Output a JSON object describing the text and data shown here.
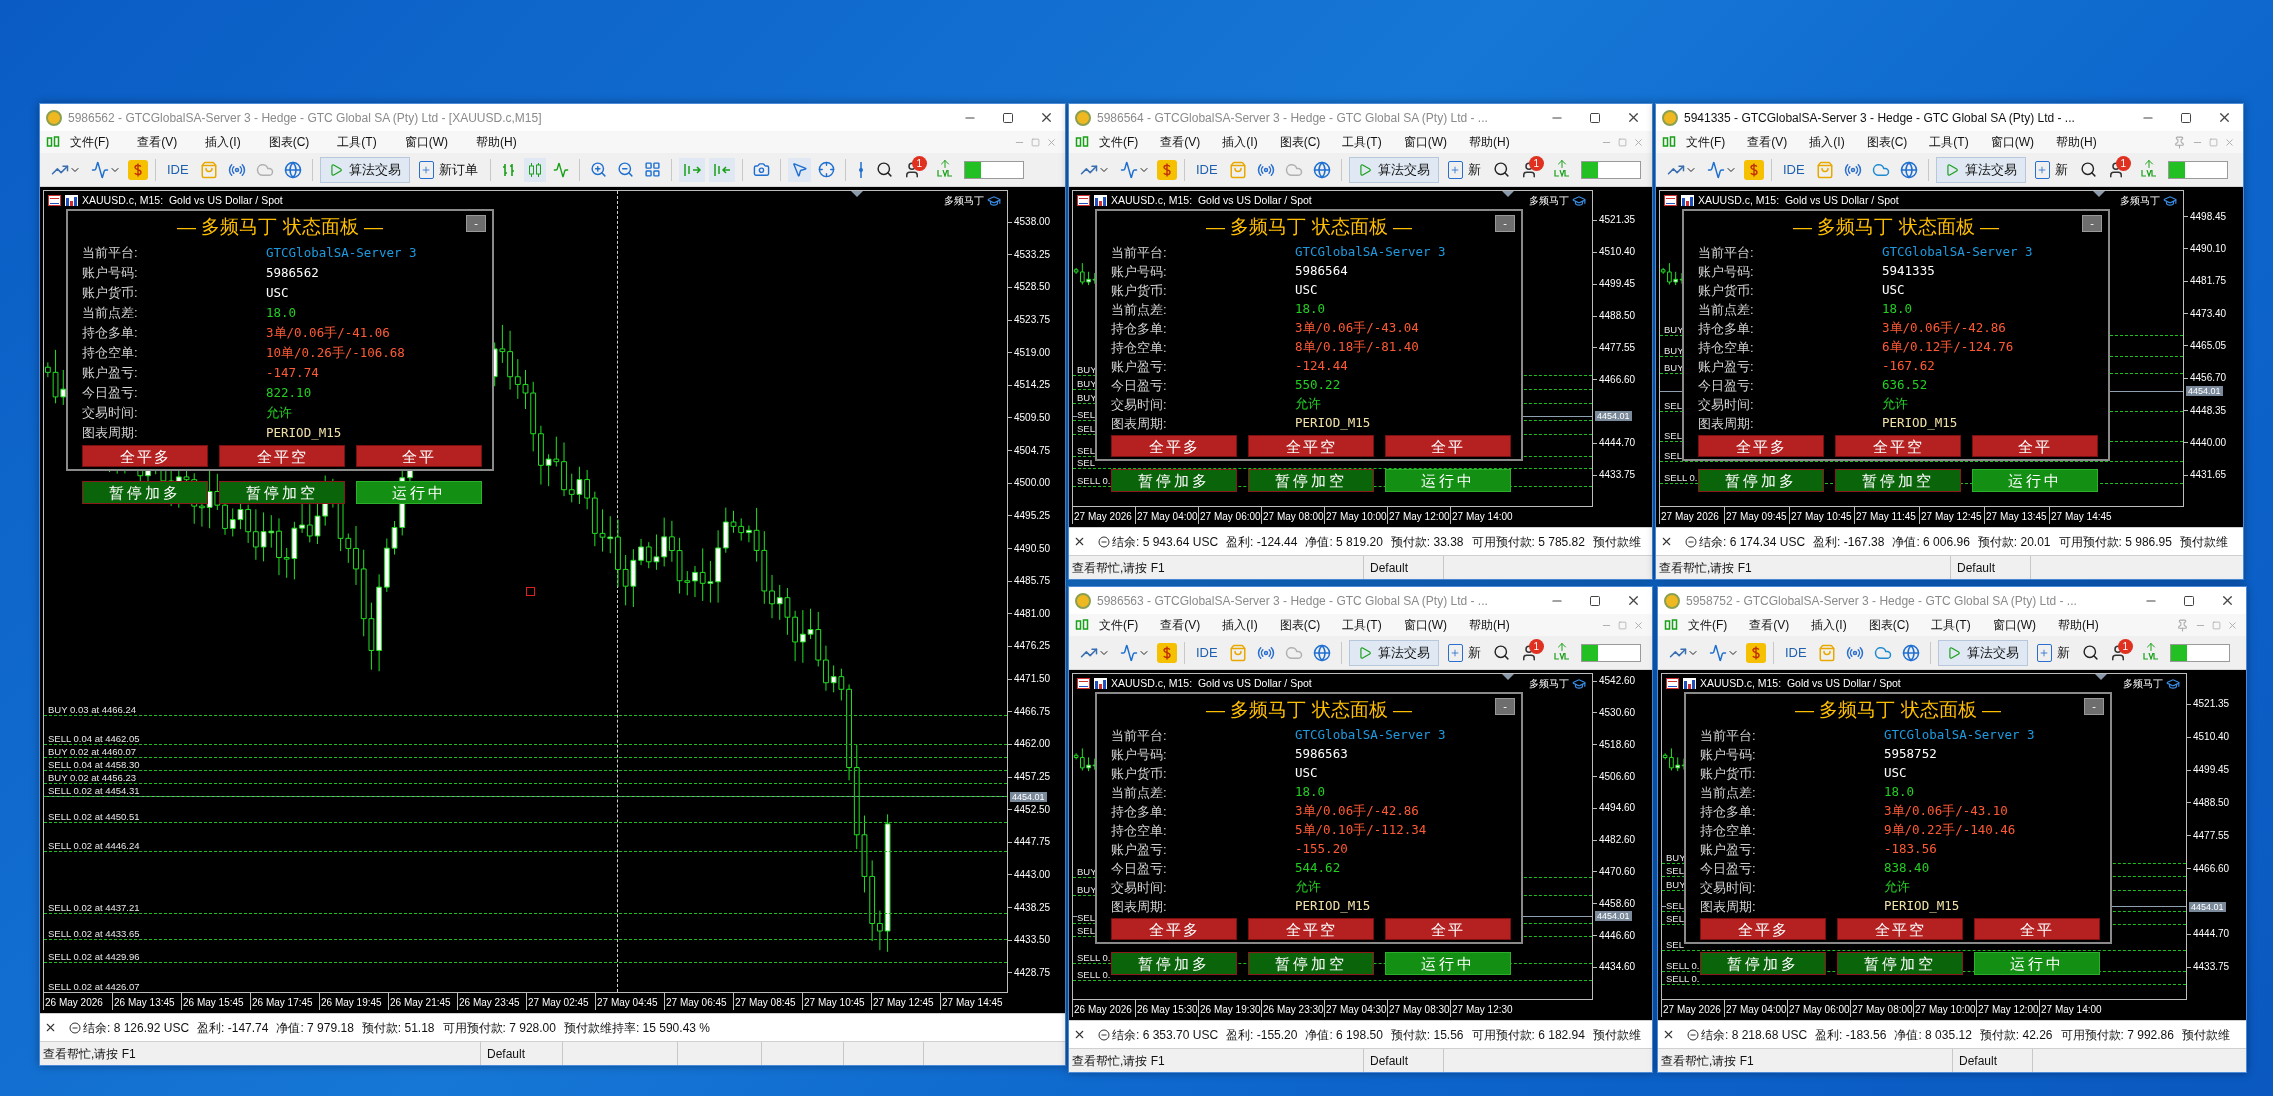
{
  "windows": [
    {
      "title": "5986562 - GTCGlobalSA-Server 3 - Hedge - GTC Global SA (Pty) Ltd - [XAUUSD.c,M15]",
      "active": false,
      "menu": [
        "文件(F)",
        "查看(V)",
        "插入(I)",
        "图表(C)",
        "工具(T)",
        "窗口(W)",
        "帮助(H)"
      ],
      "toolbar": {
        "kind": "full",
        "ide": "IDE",
        "algo": "算法交易",
        "new_order": "新订单",
        "badge": "1"
      },
      "chart": {
        "symbol": "XAUUSD.c, M15:  Gold vs US Dollar / Spot",
        "ea": "多频马丁",
        "price_ticks": [
          "4538.00",
          "4533.25",
          "4528.50",
          "4523.75",
          "4519.00",
          "4514.25",
          "4509.50",
          "4504.75",
          "4500.00",
          "4495.25",
          "4490.50",
          "4485.75",
          "4481.00",
          "4476.25",
          "4471.50",
          "4466.75",
          "4462.00",
          "4457.25",
          "4452.50",
          "4447.75",
          "4443.00",
          "4438.25",
          "4433.50",
          "4428.75"
        ],
        "current_price": "4454.01",
        "time_ticks": [
          "26 May 2026",
          "26 May 13:45",
          "26 May 15:45",
          "26 May 17:45",
          "26 May 19:45",
          "26 May 21:45",
          "26 May 23:45",
          "27 May 02:45",
          "27 May 04:45",
          "27 May 06:45",
          "27 May 08:45",
          "27 May 10:45",
          "27 May 12:45",
          "27 May 14:45"
        ],
        "order_labels": [
          "BUY 0.03 at 4466.24",
          "SELL 0.04 at 4462.05",
          "BUY 0.02 at 4460.07",
          "SELL 0.04 at 4458.30",
          "BUY 0.02 at 4456.23",
          "SELL 0.02 at 4454.31",
          "SELL 0.02 at 4450.51",
          "SELL 0.02 at 4446.24",
          "SELL 0.02 at 4437.21",
          "SELL 0.02 at 4433.65",
          "SELL 0.02 at 4429.96",
          "SELL 0.02 at 4426.07"
        ]
      },
      "panel": {
        "title": "— 多频马丁 状态面板 —",
        "collapse": "-",
        "rows": [
          {
            "label": "当前平台:",
            "value": "GTCGlobalSA-Server 3",
            "kind": "server"
          },
          {
            "label": "账户号码:",
            "value": "5986562",
            "kind": "plain"
          },
          {
            "label": "账户货币:",
            "value": "USC",
            "kind": "plain"
          },
          {
            "label": "当前点差:",
            "value": "18.0",
            "kind": "good"
          },
          {
            "label": "持仓多单:",
            "value": "3单/0.06手/-41.06",
            "kind": "bad"
          },
          {
            "label": "持仓空单:",
            "value": "10单/0.26手/-106.68",
            "kind": "bad"
          },
          {
            "label": "账户盈亏:",
            "value": "-147.74",
            "kind": "bad"
          },
          {
            "label": "今日盈亏:",
            "value": "822.10",
            "kind": "good"
          },
          {
            "label": "交易时间:",
            "value": "允许",
            "kind": "good"
          },
          {
            "label": "图表周期:",
            "value": "PERIOD_M15",
            "kind": "period"
          }
        ],
        "close_buttons": [
          "全平多",
          "全平空",
          "全平"
        ],
        "mode_buttons": [
          {
            "label": "暂停加多",
            "on": false
          },
          {
            "label": "暂停加空",
            "on": false
          },
          {
            "label": "运行中",
            "on": true
          }
        ]
      },
      "account": [
        "结余: 8 126.92 USC",
        "盈利: -147.74",
        "净值: 7 979.18",
        "预付款: 51.18",
        "可用预付款: 7 928.00",
        "预付款维持率: 15 590.43 %"
      ],
      "status_bar": {
        "help": "查看帮忙,请按 F1",
        "profile": "Default"
      }
    },
    {
      "title": "5986564 - GTCGlobalSA-Server 3 - Hedge - GTC Global SA (Pty) Ltd - ...",
      "active": false,
      "menu": [
        "文件(F)",
        "查看(V)",
        "插入(I)",
        "图表(C)",
        "工具(T)",
        "窗口(W)",
        "帮助(H)"
      ],
      "toolbar": {
        "kind": "compact",
        "ide": "IDE",
        "algo": "算法交易",
        "new_order": "新",
        "badge": "1"
      },
      "chart": {
        "symbol": "XAUUSD.c, M15:  Gold vs US Dollar / Spot",
        "ea": "多频马丁",
        "price_ticks": [
          "4521.35",
          "4510.40",
          "4499.45",
          "4488.50",
          "4477.55",
          "4466.60",
          "4444.70",
          "4433.75"
        ],
        "current_price": "4454.01",
        "time_ticks": [
          "27 May 2026",
          "27 May 04:00",
          "27 May 06:00",
          "27 May 08:00",
          "27 May 10:00",
          "27 May 12:00",
          "27 May 14:00"
        ],
        "order_labels": [
          "BUY",
          "BUY",
          "BUY",
          "SEL",
          "SEL",
          "SEL",
          "SEL",
          "SELL 0."
        ]
      },
      "panel": {
        "title": "— 多频马丁 状态面板 —",
        "collapse": "-",
        "rows": [
          {
            "label": "当前平台:",
            "value": "GTCGlobalSA-Server 3",
            "kind": "server"
          },
          {
            "label": "账户号码:",
            "value": "5986564",
            "kind": "plain"
          },
          {
            "label": "账户货币:",
            "value": "USC",
            "kind": "plain"
          },
          {
            "label": "当前点差:",
            "value": "18.0",
            "kind": "good"
          },
          {
            "label": "持仓多单:",
            "value": "3单/0.06手/-43.04",
            "kind": "bad"
          },
          {
            "label": "持仓空单:",
            "value": "8单/0.18手/-81.40",
            "kind": "bad"
          },
          {
            "label": "账户盈亏:",
            "value": "-124.44",
            "kind": "bad"
          },
          {
            "label": "今日盈亏:",
            "value": "550.22",
            "kind": "good"
          },
          {
            "label": "交易时间:",
            "value": "允许",
            "kind": "good"
          },
          {
            "label": "图表周期:",
            "value": "PERIOD_M15",
            "kind": "period"
          }
        ],
        "close_buttons": [
          "全平多",
          "全平空",
          "全平"
        ],
        "mode_buttons": [
          {
            "label": "暂停加多",
            "on": false
          },
          {
            "label": "暂停加空",
            "on": false
          },
          {
            "label": "运行中",
            "on": true
          }
        ]
      },
      "account": [
        "结余: 5 943.64 USC",
        "盈利: -124.44",
        "净值: 5 819.20",
        "预付款: 33.38",
        "可用预付款: 5 785.82",
        "预付款维"
      ],
      "status_bar": {
        "help": "查看帮忙,请按 F1",
        "profile": "Default"
      }
    },
    {
      "title": "5941335 - GTCGlobalSA-Server 3 - Hedge - GTC Global SA (Pty) Ltd - ...",
      "active": true,
      "menu": [
        "文件(F)",
        "查看(V)",
        "插入(I)",
        "图表(C)",
        "工具(T)",
        "窗口(W)",
        "帮助(H)"
      ],
      "toolbar": {
        "kind": "compact",
        "ide": "IDE",
        "algo": "算法交易",
        "new_order": "新",
        "badge": "1"
      },
      "chart": {
        "symbol": "XAUUSD.c, M15:  Gold vs US Dollar / Spot",
        "ea": "多频马丁",
        "price_ticks": [
          "4498.45",
          "4490.10",
          "4481.75",
          "4473.40",
          "4465.05",
          "4456.70",
          "4448.35",
          "4440.00",
          "4431.65"
        ],
        "current_price": "4454.01",
        "time_ticks": [
          "27 May 2026",
          "27 May 09:45",
          "27 May 10:45",
          "27 May 11:45",
          "27 May 12:45",
          "27 May 13:45",
          "27 May 14:45"
        ],
        "order_labels": [
          "BUY",
          "BUY",
          "BUY",
          "SEL",
          "SEL",
          "SEL",
          "SELL 0."
        ]
      },
      "panel": {
        "title": "— 多频马丁 状态面板 —",
        "collapse": "-",
        "rows": [
          {
            "label": "当前平台:",
            "value": "GTCGlobalSA-Server 3",
            "kind": "server"
          },
          {
            "label": "账户号码:",
            "value": "5941335",
            "kind": "plain"
          },
          {
            "label": "账户货币:",
            "value": "USC",
            "kind": "plain"
          },
          {
            "label": "当前点差:",
            "value": "18.0",
            "kind": "good"
          },
          {
            "label": "持仓多单:",
            "value": "3单/0.06手/-42.86",
            "kind": "bad"
          },
          {
            "label": "持仓空单:",
            "value": "6单/0.12手/-124.76",
            "kind": "bad"
          },
          {
            "label": "账户盈亏:",
            "value": "-167.62",
            "kind": "bad"
          },
          {
            "label": "今日盈亏:",
            "value": "636.52",
            "kind": "good"
          },
          {
            "label": "交易时间:",
            "value": "允许",
            "kind": "good"
          },
          {
            "label": "图表周期:",
            "value": "PERIOD_M15",
            "kind": "period"
          }
        ],
        "close_buttons": [
          "全平多",
          "全平空",
          "全平"
        ],
        "mode_buttons": [
          {
            "label": "暂停加多",
            "on": false
          },
          {
            "label": "暂停加空",
            "on": false
          },
          {
            "label": "运行中",
            "on": true
          }
        ]
      },
      "account": [
        "结余: 6 174.34 USC",
        "盈利: -167.38",
        "净值: 6 006.96",
        "预付款: 20.01",
        "可用预付款: 5 986.95",
        "预付款维"
      ],
      "status_bar": {
        "help": "查看帮忙,请按 F1",
        "profile": "Default"
      }
    },
    {
      "title": "5986563 - GTCGlobalSA-Server 3 - Hedge - GTC Global SA (Pty) Ltd - ...",
      "active": false,
      "menu": [
        "文件(F)",
        "查看(V)",
        "插入(I)",
        "图表(C)",
        "工具(T)",
        "窗口(W)",
        "帮助(H)"
      ],
      "toolbar": {
        "kind": "compact",
        "ide": "IDE",
        "algo": "算法交易",
        "new_order": "新",
        "badge": "1"
      },
      "chart": {
        "symbol": "XAUUSD.c, M15:  Gold vs US Dollar / Spot",
        "ea": "多频马丁",
        "price_ticks": [
          "4542.60",
          "4530.60",
          "4518.60",
          "4506.60",
          "4494.60",
          "4482.60",
          "4470.60",
          "4458.60",
          "4446.60",
          "4434.60"
        ],
        "current_price": "4454.01",
        "time_ticks": [
          "26 May 2026",
          "26 May 15:30",
          "26 May 19:30",
          "26 May 23:30",
          "27 May 04:30",
          "27 May 08:30",
          "27 May 12:30"
        ],
        "order_labels": [
          "BUY",
          "BUY",
          "SEL",
          "SEL",
          "SELL 0.",
          "SELL 0."
        ]
      },
      "panel": {
        "title": "— 多频马丁 状态面板 —",
        "collapse": "-",
        "rows": [
          {
            "label": "当前平台:",
            "value": "GTCGlobalSA-Server 3",
            "kind": "server"
          },
          {
            "label": "账户号码:",
            "value": "5986563",
            "kind": "plain"
          },
          {
            "label": "账户货币:",
            "value": "USC",
            "kind": "plain"
          },
          {
            "label": "当前点差:",
            "value": "18.0",
            "kind": "good"
          },
          {
            "label": "持仓多单:",
            "value": "3单/0.06手/-42.86",
            "kind": "bad"
          },
          {
            "label": "持仓空单:",
            "value": "5单/0.10手/-112.34",
            "kind": "bad"
          },
          {
            "label": "账户盈亏:",
            "value": "-155.20",
            "kind": "bad"
          },
          {
            "label": "今日盈亏:",
            "value": "544.62",
            "kind": "good"
          },
          {
            "label": "交易时间:",
            "value": "允许",
            "kind": "good"
          },
          {
            "label": "图表周期:",
            "value": "PERIOD_M15",
            "kind": "period"
          }
        ],
        "close_buttons": [
          "全平多",
          "全平空",
          "全平"
        ],
        "mode_buttons": [
          {
            "label": "暂停加多",
            "on": false
          },
          {
            "label": "暂停加空",
            "on": false
          },
          {
            "label": "运行中",
            "on": true
          }
        ]
      },
      "account": [
        "结余: 6 353.70 USC",
        "盈利: -155.20",
        "净值: 6 198.50",
        "预付款: 15.56",
        "可用预付款: 6 182.94",
        "预付款维"
      ],
      "status_bar": {
        "help": "查看帮忙,请按 F1",
        "profile": "Default"
      }
    },
    {
      "title": "5958752 - GTCGlobalSA-Server 3 - Hedge - GTC Global SA (Pty) Ltd - ...",
      "active": false,
      "menu": [
        "文件(F)",
        "查看(V)",
        "插入(I)",
        "图表(C)",
        "工具(T)",
        "窗口(W)",
        "帮助(H)"
      ],
      "toolbar": {
        "kind": "compact",
        "ide": "IDE",
        "algo": "算法交易",
        "new_order": "新",
        "badge": "1"
      },
      "chart": {
        "symbol": "XAUUSD.c, M15:  Gold vs US Dollar / Spot",
        "ea": "多频马丁",
        "price_ticks": [
          "4521.35",
          "4510.40",
          "4499.45",
          "4488.50",
          "4477.55",
          "4466.60",
          "4444.70",
          "4433.75"
        ],
        "current_price": "4454.01",
        "time_ticks": [
          "27 May 2026",
          "27 May 04:00",
          "27 May 06:00",
          "27 May 08:00",
          "27 May 10:00",
          "27 May 12:00",
          "27 May 14:00"
        ],
        "order_labels": [
          "BUY",
          "SEL",
          "BUY",
          "SEL",
          "SEL",
          "SEL",
          "SELL 0.",
          "SELL 0."
        ]
      },
      "panel": {
        "title": "— 多频马丁 状态面板 —",
        "collapse": "-",
        "rows": [
          {
            "label": "当前平台:",
            "value": "GTCGlobalSA-Server 3",
            "kind": "server"
          },
          {
            "label": "账户号码:",
            "value": "5958752",
            "kind": "plain"
          },
          {
            "label": "账户货币:",
            "value": "USC",
            "kind": "plain"
          },
          {
            "label": "当前点差:",
            "value": "18.0",
            "kind": "good"
          },
          {
            "label": "持仓多单:",
            "value": "3单/0.06手/-43.10",
            "kind": "bad"
          },
          {
            "label": "持仓空单:",
            "value": "9单/0.22手/-140.46",
            "kind": "bad"
          },
          {
            "label": "账户盈亏:",
            "value": "-183.56",
            "kind": "bad"
          },
          {
            "label": "今日盈亏:",
            "value": "838.40",
            "kind": "good"
          },
          {
            "label": "交易时间:",
            "value": "允许",
            "kind": "good"
          },
          {
            "label": "图表周期:",
            "value": "PERIOD_M15",
            "kind": "period"
          }
        ],
        "close_buttons": [
          "全平多",
          "全平空",
          "全平"
        ],
        "mode_buttons": [
          {
            "label": "暂停加多",
            "on": false
          },
          {
            "label": "暂停加空",
            "on": false
          },
          {
            "label": "运行中",
            "on": true
          }
        ]
      },
      "account": [
        "结余: 8 218.68 USC",
        "盈利: -183.56",
        "净值: 8 035.12",
        "预付款: 42.26",
        "可用预付款: 7 992.86",
        "预付款维"
      ],
      "status_bar": {
        "help": "查看帮忙,请按 F1",
        "profile": "Default"
      }
    }
  ]
}
